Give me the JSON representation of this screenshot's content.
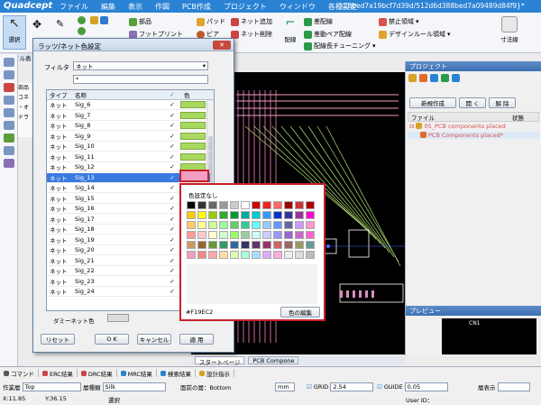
{
  "app": {
    "logo": "Quadcept",
    "doc_title": "-28bed7a19bcf7d39d/512d6d388bed7a09489d84f9}*"
  },
  "menu": [
    "ファイル",
    "編集",
    "表示",
    "作図",
    "PCB作成",
    "プロジェクト",
    "ウィンドウ",
    "各種設定"
  ],
  "ribbon": {
    "select": "選択",
    "parts": "部品",
    "footprint": "フットプリント",
    "pad": "パッド",
    "via": "ビア",
    "net_add": "ネット追加",
    "net_delete": "ネット削除",
    "wiring": "配線",
    "auto_wiring": "差配線",
    "diff_pair": "差動ペア配線",
    "length_tuning": "配線長チューニング",
    "prohibit": "禁止領域",
    "design_rule": "デザインルール領域",
    "dimension": "寸法線"
  },
  "file_tab": "ファイル表",
  "left_strip": {
    "parts": "部品",
    "com": "コネ",
    "dot": "・オ",
    "dra": "ドラ"
  },
  "dialog": {
    "title": "ラッツ/ネット色設定",
    "filter_label": "フィルタ",
    "filter_value": "ネット",
    "search_value": "*",
    "headers": {
      "type": "タイプ",
      "name": "名称",
      "color": "色"
    },
    "rows": [
      {
        "type": "ネット",
        "name": "Sig_6",
        "sel": false
      },
      {
        "type": "ネット",
        "name": "Sig_7",
        "sel": false
      },
      {
        "type": "ネット",
        "name": "Sig_8",
        "sel": false
      },
      {
        "type": "ネット",
        "name": "Sig_9",
        "sel": false
      },
      {
        "type": "ネット",
        "name": "Sig_10",
        "sel": false
      },
      {
        "type": "ネット",
        "name": "Sig_11",
        "sel": false
      },
      {
        "type": "ネット",
        "name": "Sig_12",
        "sel": false
      },
      {
        "type": "ネット",
        "name": "Sig_13",
        "sel": true
      },
      {
        "type": "ネット",
        "name": "Sig_14",
        "sel": false
      },
      {
        "type": "ネット",
        "name": "Sig_15",
        "sel": false
      },
      {
        "type": "ネット",
        "name": "Sig_16",
        "sel": false
      },
      {
        "type": "ネット",
        "name": "Sig_17",
        "sel": false
      },
      {
        "type": "ネット",
        "name": "Sig_18",
        "sel": false
      },
      {
        "type": "ネット",
        "name": "Sig_19",
        "sel": false
      },
      {
        "type": "ネット",
        "name": "Sig_20",
        "sel": false
      },
      {
        "type": "ネット",
        "name": "Sig_21",
        "sel": false
      },
      {
        "type": "ネット",
        "name": "Sig_22",
        "sel": false
      },
      {
        "type": "ネット",
        "name": "Sig_23",
        "sel": false
      },
      {
        "type": "ネット",
        "name": "Sig_24",
        "sel": false
      }
    ],
    "dummy_label": "ダミーネット色",
    "reset": "リセット",
    "ok": "O K",
    "cancel": "キャンセル",
    "apply": "適 用"
  },
  "palette": {
    "no_color": "色設定なし",
    "hex": "#F19EC2",
    "edit": "色の編集"
  },
  "project": {
    "title": "プロジェクト",
    "new": "新規作成",
    "open": "開 く",
    "release": "解 除",
    "col_file": "ファイル",
    "col_status": "状態",
    "item1": "05_PCB components placed",
    "item2": "PCB Components placed*"
  },
  "preview": {
    "title": "プレビュー",
    "label": "CN1"
  },
  "doc_tabs": {
    "start": "スタートページ",
    "pcb": "PCB Compone"
  },
  "result_tabs": [
    "コマンド",
    "ERC結果",
    "DRC結果",
    "MRC結果",
    "検索結果",
    "設計指示"
  ],
  "status": {
    "work_layer": "作業層",
    "work_value": "Top",
    "layer_type": "層種類",
    "layer_value": "Silk",
    "face": "面前の層：Bottom",
    "unit": "mm",
    "grid_label": "GRID",
    "grid_value": "2.54",
    "guide_label": "GUIDE",
    "guide_value": "0.05",
    "disp": "層表示",
    "x": "X:11.85",
    "y": "Y:36.15",
    "mode": "選択",
    "user": "User ID："
  },
  "colors": {
    "title": "#2a82d4",
    "selected": "#3a7ae0",
    "net_green": "#a8d860",
    "highlight": "#c8202a",
    "pcb_bg": "#000000"
  }
}
